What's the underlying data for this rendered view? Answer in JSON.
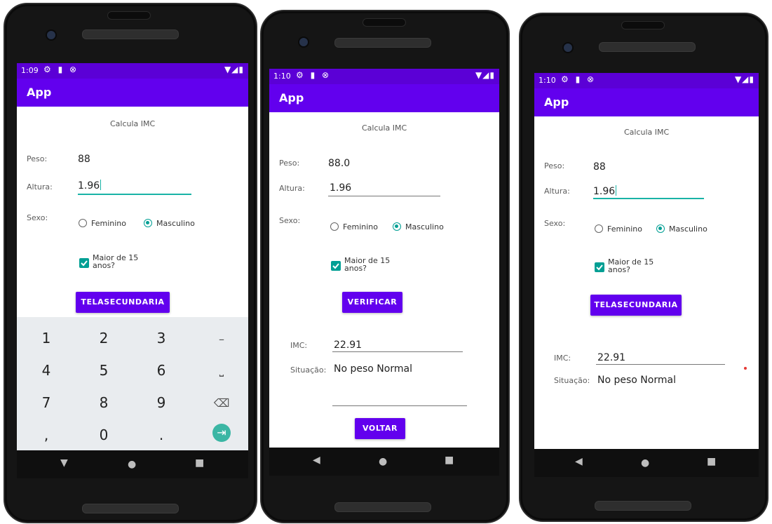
{
  "phones": [
    {
      "status_time": "1:09",
      "status_left_icons": "⚙ ▮ ⊗",
      "status_right_icons": "▼◢▮",
      "app_title": "App",
      "header_text": "Calcula IMC",
      "peso_label": "Peso:",
      "peso_value": "88",
      "altura_label": "Altura:",
      "altura_value": "1.96",
      "sexo_label": "Sexo:",
      "radio_feminino": "Feminino",
      "radio_masculino": "Masculino",
      "checkbox_line1": "Maior de 15",
      "checkbox_line2": "anos?",
      "button_label": "TELASECUNDARIA",
      "keypad": {
        "row1": [
          "1",
          "2",
          "3",
          "–"
        ],
        "row2": [
          "4",
          "5",
          "6",
          "⎵"
        ],
        "row3": [
          "7",
          "8",
          "9",
          "⌫"
        ],
        "row4": [
          ",",
          "0",
          ".",
          "⇥"
        ]
      },
      "nav": {
        "back": "▼",
        "home": "●",
        "recents": "■"
      }
    },
    {
      "status_time": "1:10",
      "status_left_icons": "⚙ ▮ ⊗",
      "status_right_icons": "▼◢▮",
      "app_title": "App",
      "header_text": "Calcula IMC",
      "peso_label": "Peso:",
      "peso_value": "88.0",
      "altura_label": "Altura:",
      "altura_value": "1.96",
      "sexo_label": "Sexo:",
      "radio_feminino": "Feminino",
      "radio_masculino": "Masculino",
      "checkbox_line1": "Maior de 15",
      "checkbox_line2": "anos?",
      "button_label": "VERIFICAR",
      "imc_label": "IMC:",
      "imc_value": "22.91",
      "situacao_label": "Situação:",
      "situacao_value": "No peso Normal",
      "voltar_label": "VOLTAR",
      "nav": {
        "back": "◀",
        "home": "●",
        "recents": "■"
      }
    },
    {
      "status_time": "1:10",
      "status_left_icons": "⚙ ▮ ⊗",
      "status_right_icons": "▼◢▮",
      "app_title": "App",
      "header_text": "Calcula IMC",
      "peso_label": "Peso:",
      "peso_value": "88",
      "altura_label": "Altura:",
      "altura_value": "1.96",
      "sexo_label": "Sexo:",
      "radio_feminino": "Feminino",
      "radio_masculino": "Masculino",
      "checkbox_line1": "Maior de 15",
      "checkbox_line2": "anos?",
      "button_label": "TELASECUNDARIA",
      "imc_label": "IMC:",
      "imc_value": "22.91",
      "situacao_label": "Situação:",
      "situacao_value": "No peso Normal",
      "nav": {
        "back": "◀",
        "home": "●",
        "recents": "■"
      }
    }
  ]
}
